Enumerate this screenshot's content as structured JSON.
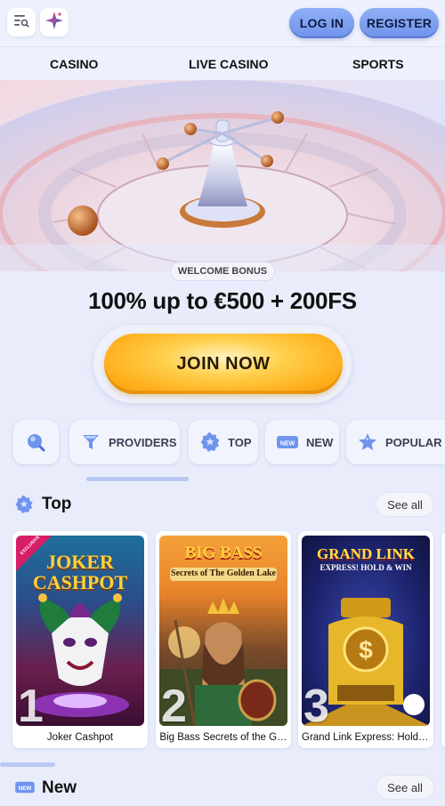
{
  "header": {
    "login_label": "LOG IN",
    "register_label": "REGISTER"
  },
  "nav": {
    "items": [
      "CASINO",
      "LIVE CASINO",
      "SPORTS"
    ]
  },
  "promo": {
    "badge": "WELCOME BONUS",
    "headline": "100% up to €500 + 200FS",
    "cta_label": "JOIN NOW"
  },
  "categories": [
    {
      "label": "",
      "icon": "search-icon"
    },
    {
      "label": "PROVIDERS",
      "icon": "funnel-icon"
    },
    {
      "label": "TOP",
      "icon": "star-badge-icon"
    },
    {
      "label": "NEW",
      "icon": "new-tag-icon"
    },
    {
      "label": "POPULAR",
      "icon": "star-icon"
    }
  ],
  "sections": {
    "top": {
      "title": "Top",
      "see_all": "See all"
    },
    "new": {
      "title": "New",
      "see_all": "See all"
    }
  },
  "games": [
    {
      "rank": "1",
      "name": "Joker Cashpot",
      "art_title": "JOKER CASHPOT",
      "ribbon": "EXCLUSIVE"
    },
    {
      "rank": "2",
      "name": "Big Bass Secrets of the G…",
      "art_title": "BIG BASS",
      "art_subtitle": "Secrets of The Golden Lake"
    },
    {
      "rank": "3",
      "name": "Grand Link Express: Hold …",
      "art_title": "GRAND LINK",
      "art_subtitle": "EXPRESS! HOLD & WIN"
    }
  ],
  "colors": {
    "background": "#e9edfb",
    "auth_button": "#7f9ff0",
    "cta_orange": "#ffb21c"
  }
}
